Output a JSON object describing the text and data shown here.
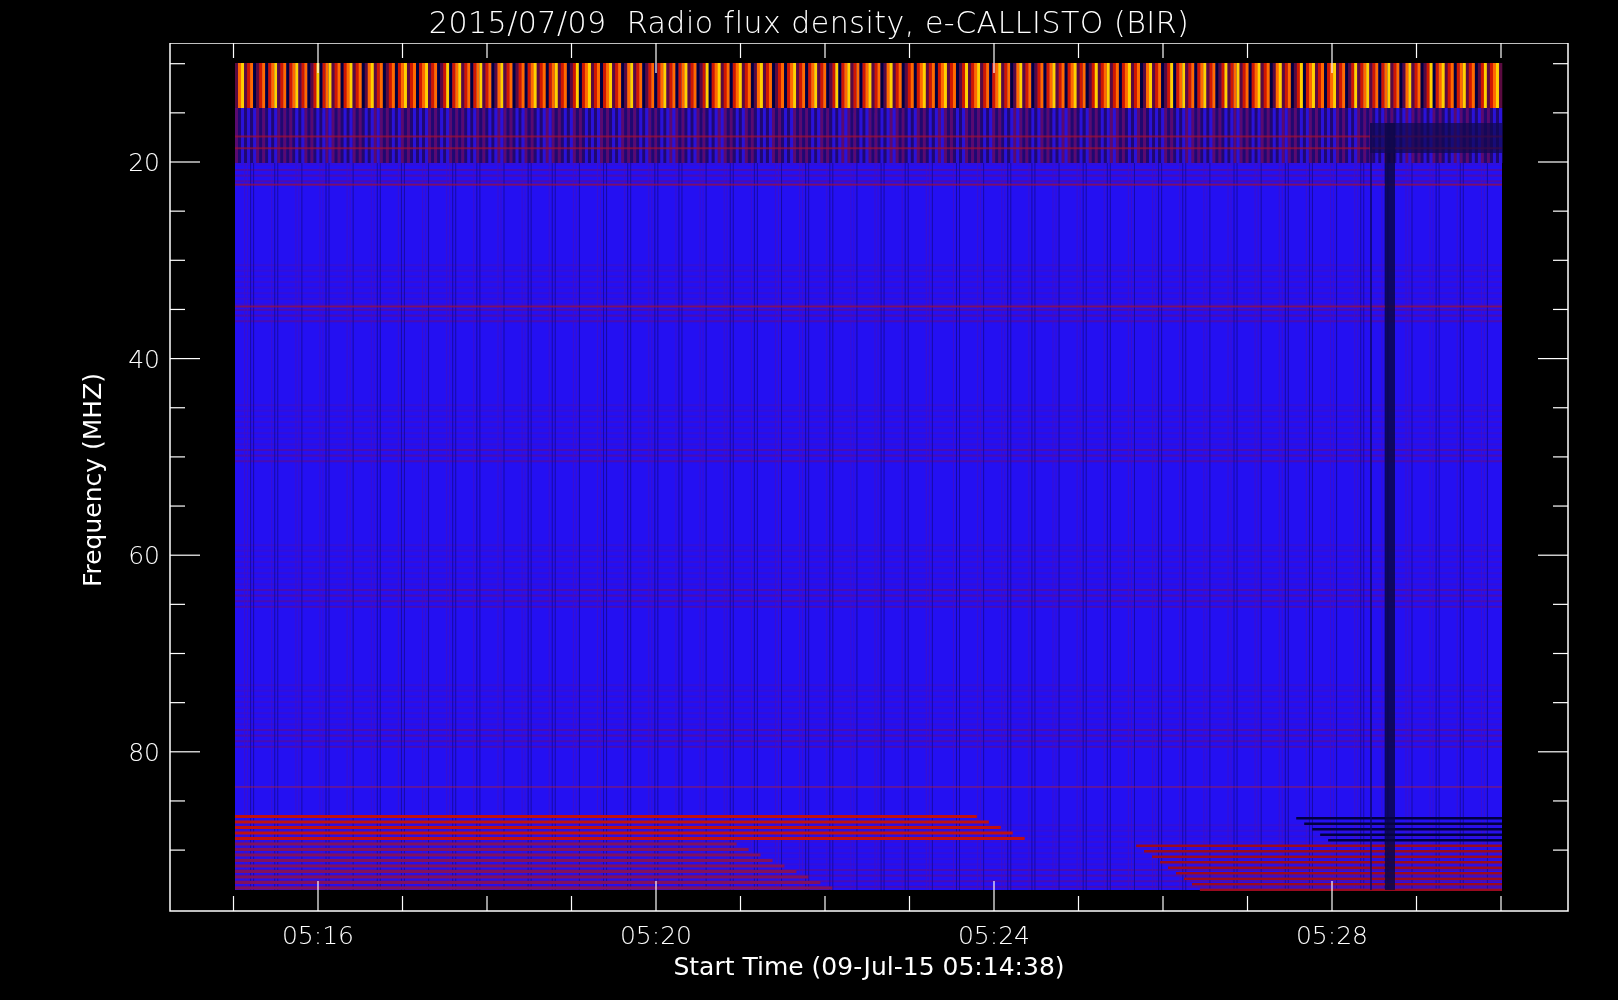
{
  "title": "2015/07/09  Radio flux density, e-CALLISTO (BIR)",
  "y_axis": {
    "label": "Frequency (MHZ)",
    "ticks": [
      "20",
      "40",
      "60",
      "80"
    ]
  },
  "x_axis": {
    "label": "Start Time (09-Jul-15 05:14:38)",
    "ticks": [
      "05:16",
      "05:20",
      "05:24",
      "05:28"
    ]
  }
}
